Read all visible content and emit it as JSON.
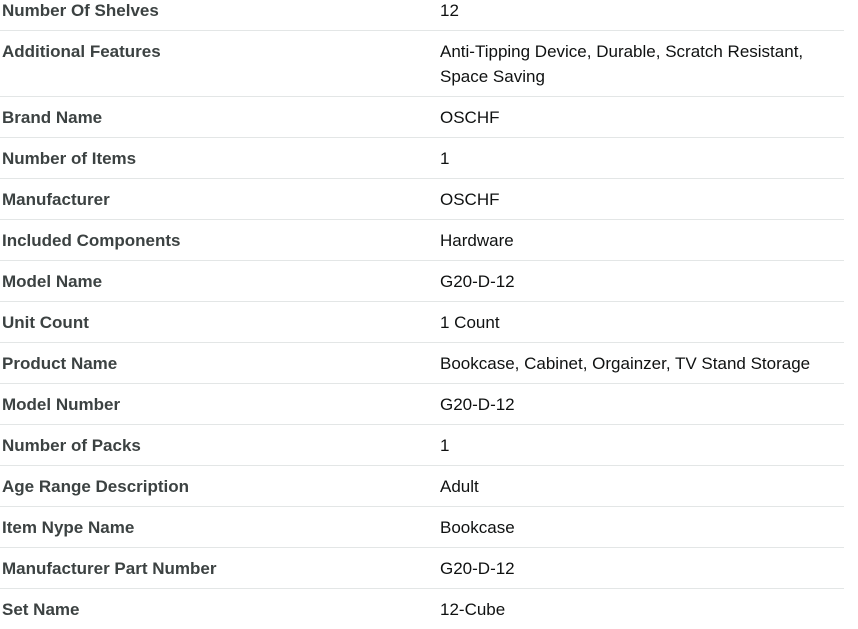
{
  "product_details": {
    "rows": [
      {
        "label": "Number Of Shelves",
        "value": "12"
      },
      {
        "label": "Additional Features",
        "value": "Anti-Tipping Device, Durable, Scratch Resistant, Space Saving"
      },
      {
        "label": "Brand Name",
        "value": "OSCHF"
      },
      {
        "label": "Number of Items",
        "value": "1"
      },
      {
        "label": "Manufacturer",
        "value": "OSCHF"
      },
      {
        "label": "Included Components",
        "value": "Hardware"
      },
      {
        "label": "Model Name",
        "value": "G20-D-12"
      },
      {
        "label": "Unit Count",
        "value": "1 Count"
      },
      {
        "label": "Product Name",
        "value": "Bookcase, Cabinet, Orgainzer, TV Stand Storage"
      },
      {
        "label": "Model Number",
        "value": "G20-D-12"
      },
      {
        "label": "Number of Packs",
        "value": "1"
      },
      {
        "label": "Age Range Description",
        "value": "Adult"
      },
      {
        "label": "Item Nype Name",
        "value": "Bookcase"
      },
      {
        "label": "Manufacturer Part Number",
        "value": "G20-D-12"
      },
      {
        "label": "Set Name",
        "value": "12-Cube"
      }
    ]
  }
}
